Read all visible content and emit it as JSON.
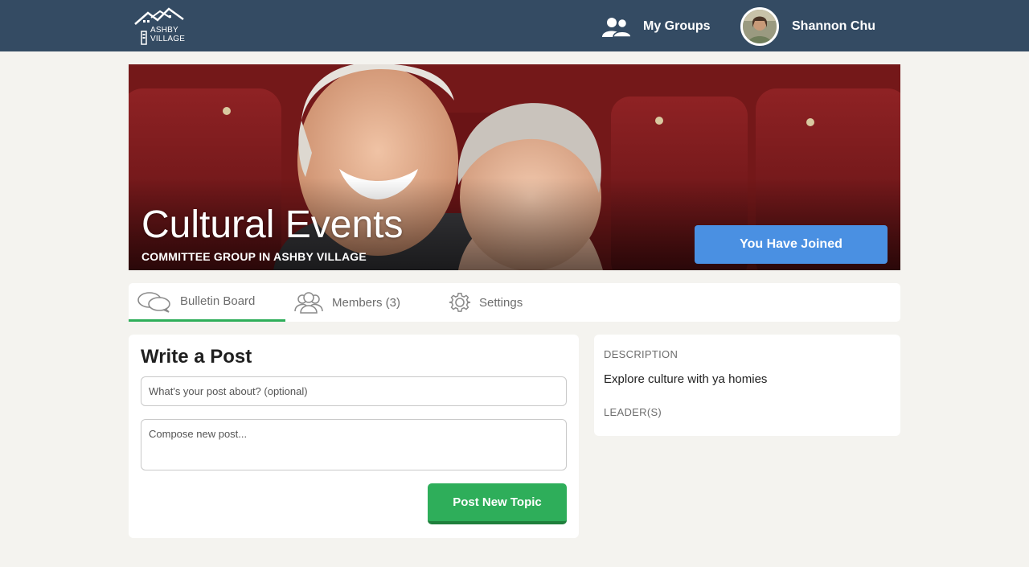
{
  "header": {
    "logo": {
      "line1": "ASHBY",
      "line2": "VILLAGE"
    },
    "my_groups_label": "My Groups",
    "user_name": "Shannon Chu"
  },
  "hero": {
    "title": "Cultural Events",
    "subtitle": "COMMITTEE GROUP IN ASHBY VILLAGE",
    "join_button": "You Have Joined"
  },
  "tabs": [
    {
      "label": "Bulletin Board",
      "icon": "speech-bubbles-icon",
      "active": true
    },
    {
      "label": "Members (3)",
      "icon": "members-icon",
      "active": false
    },
    {
      "label": "Settings",
      "icon": "gear-icon",
      "active": false
    }
  ],
  "compose": {
    "title": "Write a Post",
    "subject_placeholder": "What's your post about? (optional)",
    "body_placeholder": "Compose new post...",
    "submit_label": "Post New Topic"
  },
  "sidebar": {
    "description_label": "DESCRIPTION",
    "description": "Explore culture with ya homies",
    "leaders_label": "LEADER(S)"
  },
  "colors": {
    "topbar": "#344b63",
    "page_bg": "#f4f3ef",
    "join_blue": "#4a90e2",
    "post_green": "#2eae5a"
  }
}
